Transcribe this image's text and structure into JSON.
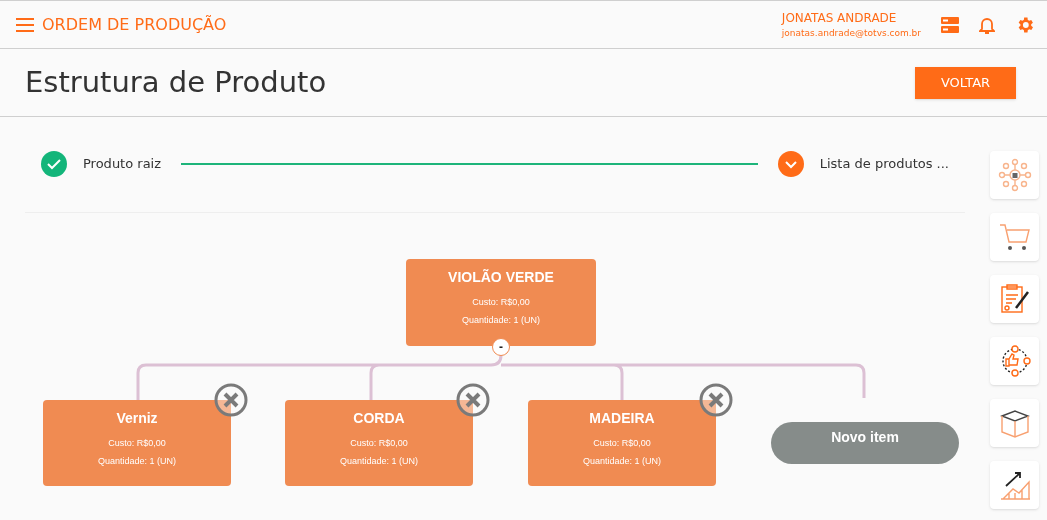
{
  "header": {
    "title": "ORDEM DE PRODUÇÃO",
    "user_name": "JONATAS ANDRADE",
    "user_email": "jonatas.andrade@totvs.com.br"
  },
  "page": {
    "title": "Estrutura de Produto",
    "back_button": "VOLTAR"
  },
  "steps": [
    {
      "label": "Produto raiz",
      "completed": true
    },
    {
      "label": "Lista de produtos ...",
      "completed": false
    }
  ],
  "tree": {
    "root": {
      "name": "VIOLÃO VERDE",
      "cost": "Custo: R$0,00",
      "quantity": "Quantidade: 1 (UN)",
      "collapse": "-"
    },
    "children": [
      {
        "kind": "item",
        "name": "Verniz",
        "cost": "Custo: R$0,00",
        "quantity": "Quantidade: 1 (UN)"
      },
      {
        "kind": "item",
        "name": "CORDA",
        "cost": "Custo: R$0,00",
        "quantity": "Quantidade: 1 (UN)"
      },
      {
        "kind": "item",
        "name": "MADEIRA",
        "cost": "Custo: R$0,00",
        "quantity": "Quantidade: 1 (UN)"
      },
      {
        "kind": "new",
        "name": "Novo item"
      }
    ]
  },
  "side_tools": [
    {
      "kind": "network"
    },
    {
      "kind": "cart"
    },
    {
      "kind": "document"
    },
    {
      "kind": "cycle"
    },
    {
      "kind": "box"
    },
    {
      "kind": "growth"
    }
  ]
}
